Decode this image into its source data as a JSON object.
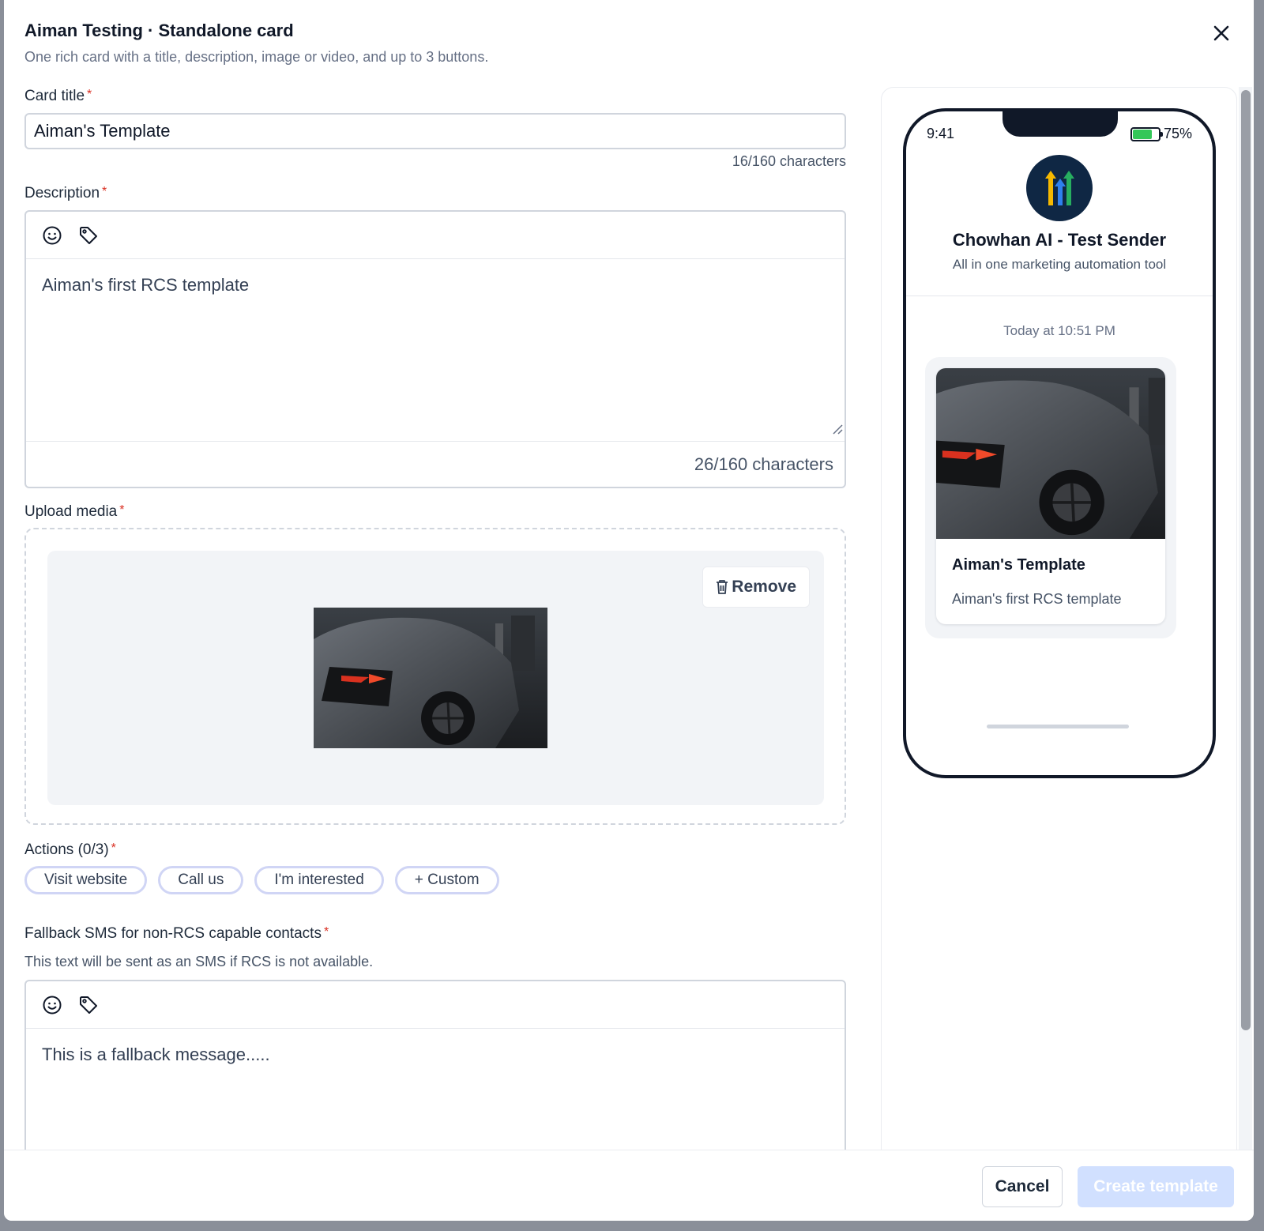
{
  "header": {
    "title": "Aiman Testing · Standalone card",
    "subtitle": "One rich card with a title, description, image or video, and up to 3 buttons."
  },
  "card_title": {
    "label": "Card title",
    "value": "Aiman's Template",
    "counter": "16/160 characters"
  },
  "description": {
    "label": "Description",
    "value": "Aiman's first RCS template",
    "counter": "26/160 characters"
  },
  "upload_media": {
    "label": "Upload media",
    "remove_label": "Remove"
  },
  "actions": {
    "label": "Actions (0/3)",
    "chips": [
      "Visit website",
      "Call us",
      "I'm interested",
      "+ Custom"
    ]
  },
  "fallback": {
    "label": "Fallback SMS for non-RCS capable contacts",
    "helper": "This text will be sent as an SMS if RCS is not available.",
    "value": "This is a fallback message....."
  },
  "required_marker": "*",
  "footer": {
    "cancel_label": "Cancel",
    "create_label": "Create template"
  },
  "preview": {
    "time": "9:41",
    "battery": "75%",
    "battery_level": 0.75,
    "sender_name": "Chowhan AI - Test Sender",
    "sender_desc": "All in one marketing automation tool",
    "timestamp": "Today at 10:51 PM",
    "card_title": "Aiman's Template",
    "card_desc": "Aiman's first RCS template"
  },
  "icons": {
    "close": "close-icon",
    "emoji": "emoji-icon",
    "tag": "tag-icon",
    "trash": "trash-icon"
  },
  "colors": {
    "required": "#d92d20",
    "primary_disabled": "#d1e0ff",
    "battery": "#34c759",
    "avatar_bg": "#0f2744"
  }
}
